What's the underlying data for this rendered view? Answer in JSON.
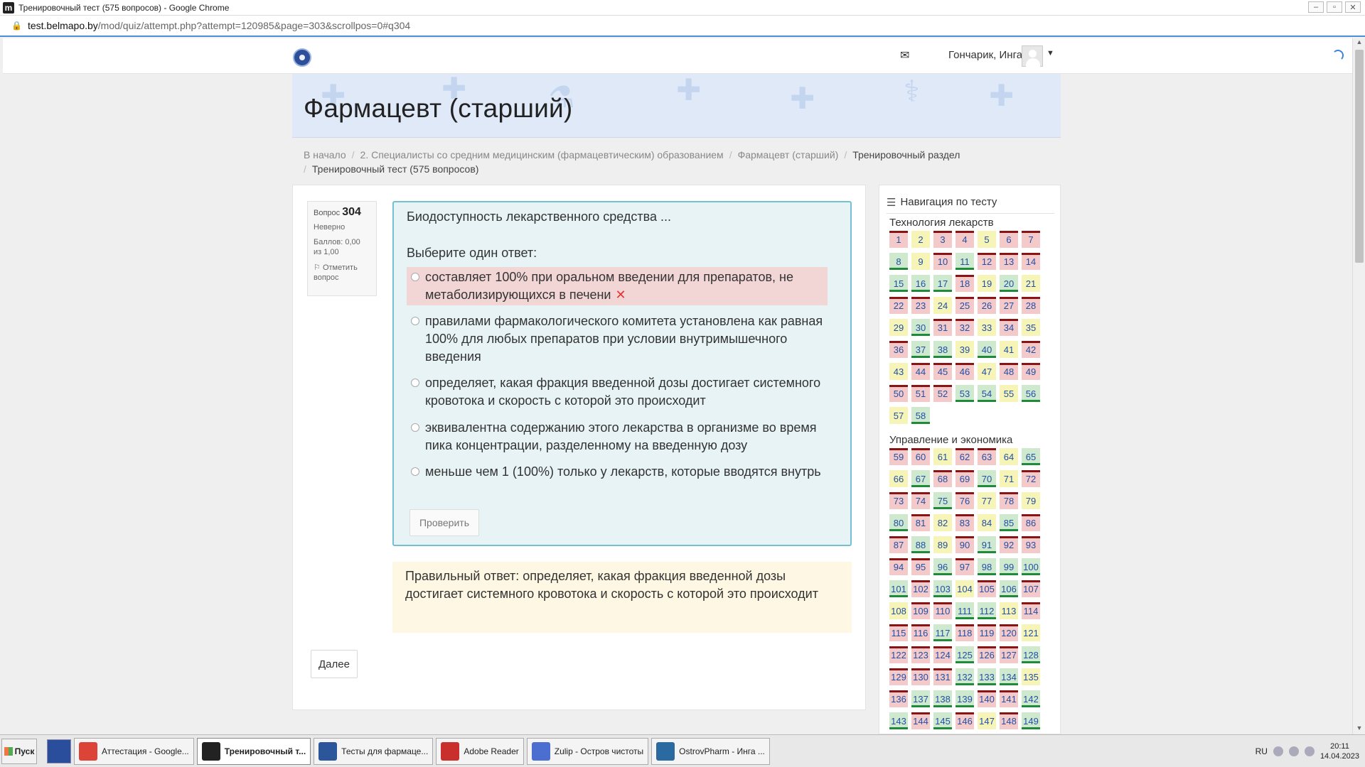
{
  "window": {
    "title": "Тренировочный тест (575 вопросов) - Google Chrome",
    "url_domain": "test.belmapo.by",
    "url_path": "/mod/quiz/attempt.php?attempt=120985&page=303&scrollpos=0#q304"
  },
  "header": {
    "username": "Гончарик, Инга"
  },
  "banner": {
    "title": "Фармацевт (старший)"
  },
  "breadcrumb": {
    "items": [
      "В начало",
      "2. Специалисты со средним медицинским (фармацевтическим) образованием",
      "Фармацевт (старший)",
      "Тренировочный раздел",
      "Тренировочный тест (575 вопросов)"
    ]
  },
  "question": {
    "label": "Вопрос",
    "number": "304",
    "state": "Неверно",
    "mark": "Баллов: 0,00 из 1,00",
    "flag": "Отметить вопрос",
    "text": "Биодоступность лекарственного средства ...",
    "prompt": "Выберите один ответ:",
    "options": [
      "составляет 100% при оральном введении для препаратов, не метаболизирующихся в печени",
      "правилами фармакологического комитета установлена как равная 100% для любых препаратов при условии внутримышечного введения",
      "определяет, какая фракция введенной дозы достигает системного кровотока и скорость с которой это происходит",
      "эквивалентна содержанию этого лекарства в организме во время пика концентрации, разделенному на введенную дозу",
      "меньше чем 1 (100%) только у лекарств, которые вводятся внутрь"
    ],
    "selected_option_index": 0,
    "check_button": "Проверить",
    "feedback": "Правильный ответ: определяет, какая фракция введенной дозы достигает системного кровотока и скорость с которой это происходит",
    "next_button": "Далее"
  },
  "nav": {
    "title": "Навигация по тесту",
    "sections": [
      {
        "name": "Технология лекарств",
        "numbers": [
          "1",
          "2",
          "3",
          "4",
          "5",
          "6",
          "7",
          "8",
          "9",
          "10",
          "11",
          "12",
          "13",
          "14",
          "15",
          "16",
          "17",
          "18",
          "19",
          "20",
          "21",
          "22",
          "23",
          "24",
          "25",
          "26",
          "27",
          "28",
          "29",
          "30",
          "31",
          "32",
          "33",
          "34",
          "35",
          "36",
          "37",
          "38",
          "39",
          "40",
          "41",
          "42",
          "43",
          "44",
          "45",
          "46",
          "47",
          "48",
          "49",
          "50",
          "51",
          "52",
          "53",
          "54",
          "55",
          "56",
          "57",
          "58"
        ],
        "states": "wpwwpww cpwcwww cccwpcp wwpwwww pcwwpwp wccpcpw pwwwpww wwwccpc pc"
      },
      {
        "name": "Управление и экономика",
        "numbers": [
          "59",
          "60",
          "61",
          "62",
          "63",
          "64",
          "65",
          "66",
          "67",
          "68",
          "69",
          "70",
          "71",
          "72",
          "73",
          "74",
          "75",
          "76",
          "77",
          "78",
          "79",
          "80",
          "81",
          "82",
          "83",
          "84",
          "85",
          "86",
          "87",
          "88",
          "89",
          "90",
          "91",
          "92",
          "93",
          "94",
          "95",
          "96",
          "97",
          "98",
          "99",
          "100",
          "101",
          "102",
          "103",
          "104",
          "105",
          "106",
          "107",
          "108",
          "109",
          "110",
          "111",
          "112",
          "113",
          "114",
          "115",
          "116",
          "117",
          "118",
          "119",
          "120",
          "121",
          "122",
          "123",
          "124",
          "125",
          "126",
          "127",
          "128",
          "129",
          "130",
          "131",
          "132",
          "133",
          "134",
          "135",
          "136",
          "137",
          "138",
          "139",
          "140",
          "141",
          "142",
          "143",
          "144",
          "145",
          "146",
          "147",
          "148",
          "149"
        ],
        "states": "wwpwwpc pcwwcpw wwcwpwp cwpwpcw wcpwcww wwcwccc cwcpwcw pwwccpw wwcwwwp wwwcwwc wwwcccp wcccwwc cwcwpwc"
      }
    ]
  },
  "taskbar": {
    "start": "Пуск",
    "tasks": [
      {
        "label": "Аттестация - Google...",
        "icon": "chrome-icon",
        "color": "#db4437"
      },
      {
        "label": "Тренировочный т...",
        "icon": "moodle-icon",
        "color": "#222222",
        "active": true
      },
      {
        "label": "Тесты для фармаце...",
        "icon": "word-icon",
        "color": "#2b579a"
      },
      {
        "label": "Adobe Reader",
        "icon": "adobe-reader-icon",
        "color": "#c9302c"
      },
      {
        "label": "Zulip - Остров чистоты",
        "icon": "zulip-icon",
        "color": "#4a6fd0"
      },
      {
        "label": "OstrovPharm - Инга ...",
        "icon": "ostrovpharm-icon",
        "color": "#2a6aa0"
      }
    ],
    "lang": "RU",
    "time": "20:11",
    "date": "14.04.2023"
  },
  "colors": {
    "correct": "#cfe9cf",
    "wrong": "#f4c9c9",
    "partial": "#f6f4b7",
    "question_box": "#e7f3f5",
    "feedback": "#fdf7e3",
    "accent": "#3b86d7"
  }
}
